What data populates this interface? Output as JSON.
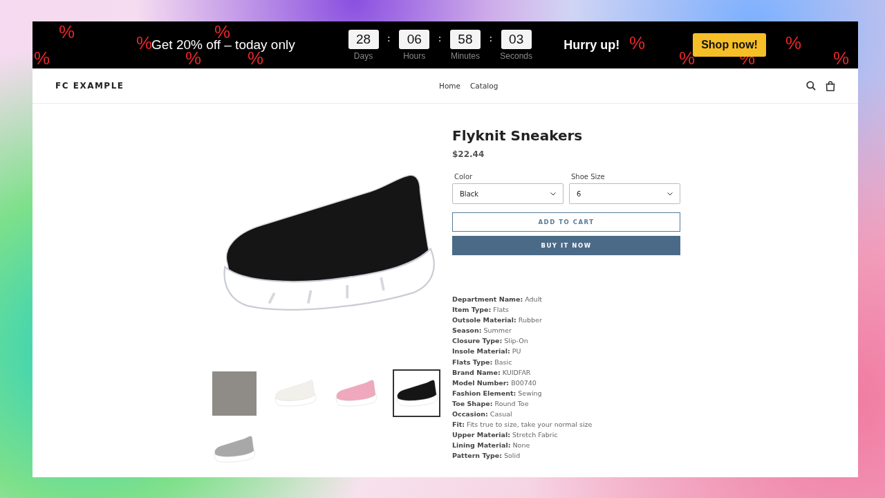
{
  "promo_bar": {
    "message": "Get 20% off – today only",
    "countdown": [
      {
        "value": "28",
        "label": "Days"
      },
      {
        "value": "06",
        "label": "Hours"
      },
      {
        "value": "58",
        "label": "Minutes"
      },
      {
        "value": "03",
        "label": "Seconds"
      }
    ],
    "separator": ":",
    "urgency": "Hurry up!",
    "button": "Shop now!",
    "marks": [
      "%",
      "%",
      "%",
      "%",
      "%",
      "%",
      "%",
      "%",
      "%",
      "%",
      "%"
    ]
  },
  "header": {
    "logo": "FC EXAMPLE",
    "nav": [
      "Home",
      "Catalog"
    ]
  },
  "product": {
    "title": "Flyknit Sneakers",
    "price": "$22.44",
    "options": [
      {
        "label": "Color",
        "value": "Black"
      },
      {
        "label": "Shoe Size",
        "value": "6"
      }
    ],
    "add_to_cart": "ADD TO CART",
    "buy_now": "BUY IT NOW",
    "thumbnails": [
      {
        "kind": "photo",
        "selected": false
      },
      {
        "kind": "shoe",
        "color": "#f2f0ea",
        "selected": false
      },
      {
        "kind": "shoe",
        "color": "#f0a8bc",
        "selected": false
      },
      {
        "kind": "shoe",
        "color": "#151515",
        "selected": true
      },
      {
        "kind": "shoe",
        "color": "#a8a8a8",
        "selected": false
      }
    ],
    "specs": [
      "**Department Name:** Adult",
      "**Item Type:** Flats",
      "**Outsole Material:** Rubber",
      "**Season:** Summer",
      "**Closure Type:** Slip-On",
      "**Insole Material:** PU",
      "**Flats Type:** Basic",
      "**Brand Name:** KUIDFAR",
      "**Model Number:** B00740",
      "**Fashion Element:** Sewing",
      "**Toe Shape:** Round Toe",
      "**Occasion:** Casual",
      "**Fit:** Fits true to size, take your normal size",
      "**Upper Material:** Stretch Fabric",
      "**Lining Material:** None",
      "**Pattern Type:** Solid"
    ]
  }
}
